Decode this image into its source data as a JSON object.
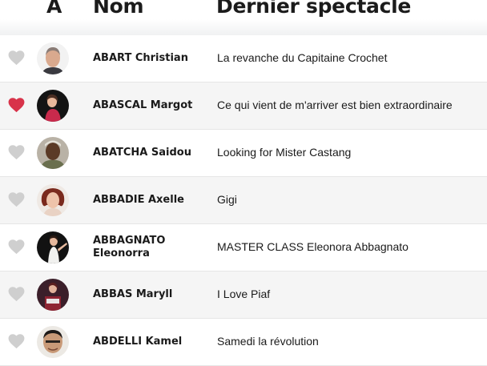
{
  "header": {
    "letter": "A",
    "name_label": "Nom",
    "show_label": "Dernier spectacle"
  },
  "colors": {
    "heart_on": "#d8334a",
    "heart_off": "#cfcfcf"
  },
  "rows": [
    {
      "name": "ABART Christian",
      "show": "La revanche du Capitaine Crochet",
      "favorite": false
    },
    {
      "name": "ABASCAL Margot",
      "show": "Ce qui vient de m'arriver est bien extraordinaire",
      "favorite": true
    },
    {
      "name": "ABATCHA Saidou",
      "show": "Looking for Mister Castang",
      "favorite": false
    },
    {
      "name": "ABBADIE Axelle",
      "show": "Gigi",
      "favorite": false
    },
    {
      "name": "ABBAGNATO Eleonorra",
      "show": "MASTER CLASS Eleonora Abbagnato",
      "favorite": false
    },
    {
      "name": "ABBAS Maryll",
      "show": "I Love Piaf",
      "favorite": false
    },
    {
      "name": "ABDELLI Kamel",
      "show": "Samedi la révolution",
      "favorite": false
    }
  ]
}
